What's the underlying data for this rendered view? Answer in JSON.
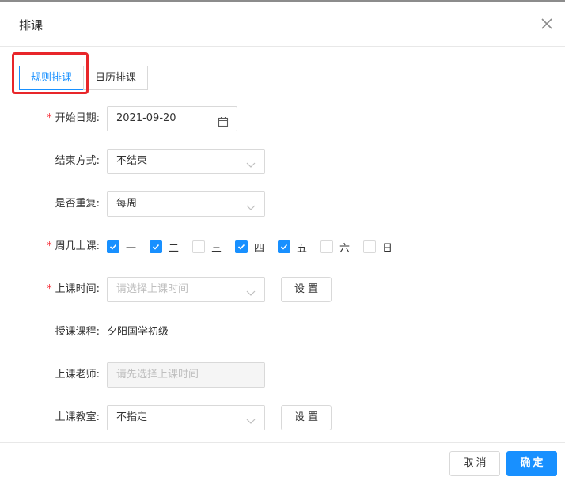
{
  "dialog": {
    "title": "排课",
    "close_icon": "close-icon"
  },
  "tabs": [
    {
      "label": "规则排课",
      "active": true
    },
    {
      "label": "日历排课",
      "active": false
    }
  ],
  "form": {
    "start_date": {
      "label": "开始日期:",
      "required": true,
      "value": "2021-09-20",
      "icon": "calendar-icon"
    },
    "end_mode": {
      "label": "结束方式:",
      "value": "不结束",
      "icon": "chevron-down-icon"
    },
    "repeat": {
      "label": "是否重复:",
      "value": "每周",
      "icon": "chevron-down-icon"
    },
    "weekdays": {
      "label": "周几上课:",
      "required": true,
      "days": [
        {
          "label": "一",
          "checked": true
        },
        {
          "label": "二",
          "checked": true
        },
        {
          "label": "三",
          "checked": false
        },
        {
          "label": "四",
          "checked": true
        },
        {
          "label": "五",
          "checked": true
        },
        {
          "label": "六",
          "checked": false
        },
        {
          "label": "日",
          "checked": false
        }
      ]
    },
    "class_time": {
      "label": "上课时间:",
      "required": true,
      "placeholder": "请选择上课时间",
      "button": "设置"
    },
    "course": {
      "label": "授课课程:",
      "value": "夕阳国学初级"
    },
    "teacher": {
      "label": "上课老师:",
      "placeholder": "请先选择上课时间"
    },
    "classroom": {
      "label": "上课教室:",
      "value": "不指定",
      "button": "设置"
    }
  },
  "footer": {
    "cancel_label": "取消",
    "ok_label": "确定"
  },
  "colors": {
    "primary": "#1890ff",
    "required": "#f5222d",
    "highlight": "#e8262a"
  }
}
